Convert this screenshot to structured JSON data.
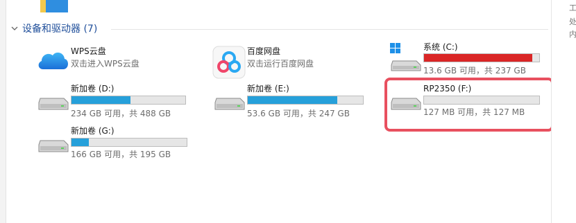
{
  "group": {
    "title": "设备和驱动器 (7)",
    "expanded": true
  },
  "right_panel": {
    "lines": [
      "工",
      "处",
      "内"
    ]
  },
  "drives": [
    {
      "id": "wps",
      "name": "WPS云盘",
      "subtitle": "双击进入WPS云盘",
      "icon": "cloud-icon"
    },
    {
      "id": "baidu",
      "name": "百度网盘",
      "subtitle": "双击运行百度网盘",
      "icon": "baidu-netdisk-icon"
    },
    {
      "id": "c",
      "name": "系统 (C:)",
      "usage": "13.6 GB 可用，共 237 GB",
      "used_fraction": 0.94,
      "warning": true,
      "icon": "windows-drive-icon"
    },
    {
      "id": "d",
      "name": "新加卷 (D:)",
      "usage": "234 GB 可用，共 488 GB",
      "used_fraction": 0.52,
      "icon": "drive-icon"
    },
    {
      "id": "e",
      "name": "新加卷 (E:)",
      "usage": "53.6 GB 可用，共 247 GB",
      "used_fraction": 0.78,
      "icon": "drive-icon"
    },
    {
      "id": "f",
      "name": "RP2350 (F:)",
      "usage": "127 MB 可用，共 127 MB",
      "used_fraction": 0.0,
      "highlighted": true,
      "icon": "drive-icon"
    },
    {
      "id": "g",
      "name": "新加卷 (G:)",
      "usage": "166 GB 可用，共 195 GB",
      "used_fraction": 0.15,
      "icon": "drive-icon"
    }
  ],
  "colors": {
    "bar_normal": "#26a0da",
    "bar_warning": "#da2626",
    "highlight": "#e8505f",
    "group_title": "#1f4e9a"
  }
}
